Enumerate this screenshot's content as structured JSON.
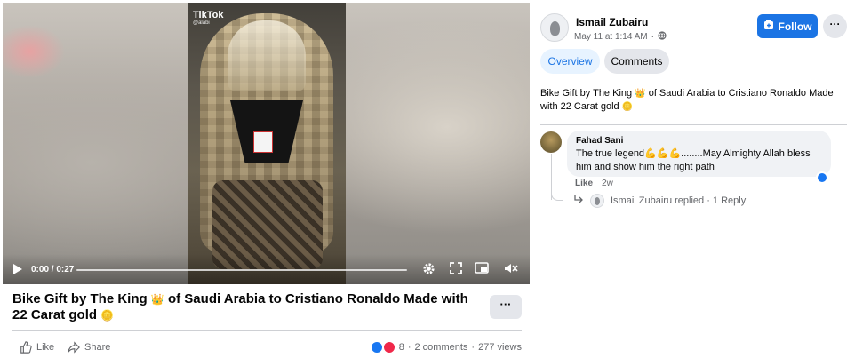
{
  "video": {
    "watermark": "TikTok",
    "watermark_sub": "@alabi",
    "time": "0:00 / 0:27",
    "progress": 0
  },
  "post": {
    "title_part1": "Bike Gift by The King ",
    "title_emoji1": "👑",
    "title_part2": " of Saudi Arabia to Cristiano Ronaldo Made with 22 Carat gold ",
    "title_emoji2": "🪙",
    "more_label": "···",
    "like_label": "Like",
    "share_label": "Share",
    "reaction_count": "8",
    "comments_count": "2 comments",
    "views": "277 views"
  },
  "sidebar": {
    "author": "Ismail Zubairu",
    "date": "May 11 at 1:14 AM",
    "follow_label": "Follow",
    "menu_label": "···",
    "tabs": [
      {
        "label": "Overview",
        "active": true
      },
      {
        "label": "Comments",
        "active": false
      }
    ],
    "description_part1": "Bike Gift by The King ",
    "description_emoji1": "👑",
    "description_part2": " of Saudi Arabia to Cristiano Ronaldo Made with 22 Carat gold ",
    "description_emoji2": "🪙"
  },
  "comment": {
    "author": "Fahad Sani",
    "text": "The true legend💪💪💪........May Almighty Allah bless him and show him the right path",
    "like_label": "Like",
    "age": "2w",
    "reply_summary": "Ismail Zubairu replied · 1 Reply"
  },
  "colors": {
    "accent": "#1b74e4",
    "muted": "#65676b",
    "tab_active_bg": "#e7f3ff"
  }
}
